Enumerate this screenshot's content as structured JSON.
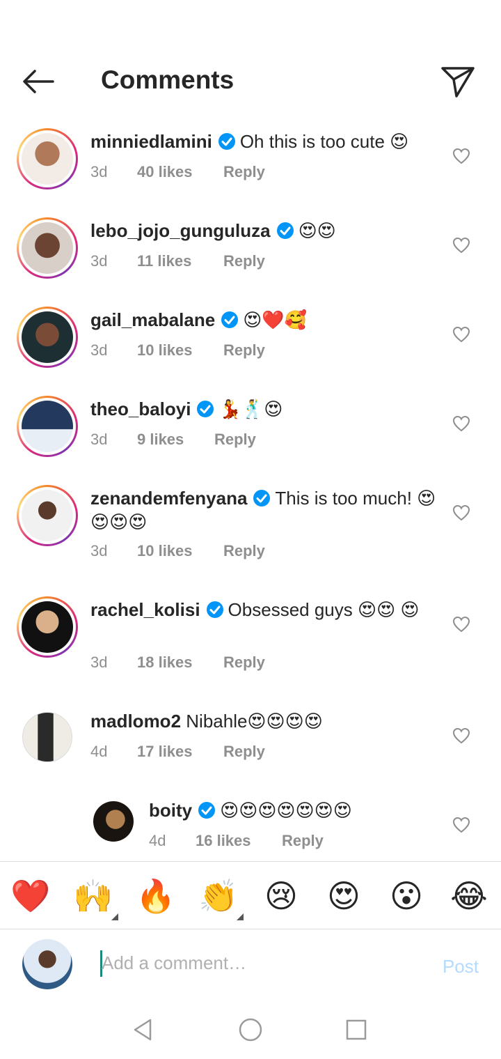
{
  "header": {
    "title": "Comments",
    "back_icon": "arrow-left-icon",
    "send_icon": "paper-plane-icon"
  },
  "comments": [
    {
      "username": "minniedlamini",
      "verified": true,
      "text": "Oh this is too cute 😍",
      "age": "3d",
      "likes": "40 likes",
      "reply": "Reply"
    },
    {
      "username": "lebo_jojo_gunguluza",
      "verified": true,
      "text": "😍😍",
      "age": "3d",
      "likes": "11 likes",
      "reply": "Reply"
    },
    {
      "username": "gail_mabalane",
      "verified": true,
      "text": "😍❤️🥰",
      "age": "3d",
      "likes": "10 likes",
      "reply": "Reply"
    },
    {
      "username": "theo_baloyi",
      "verified": true,
      "text": "💃🕺😍",
      "age": "3d",
      "likes": "9 likes",
      "reply": "Reply"
    },
    {
      "username": "zenandemfenyana",
      "verified": true,
      "text": "This is too much! 😍😍😍😍",
      "age": "3d",
      "likes": "10 likes",
      "reply": "Reply"
    },
    {
      "username": "rachel_kolisi",
      "verified": true,
      "text": "Obsessed guys 😍😍 😍",
      "age": "3d",
      "likes": "18 likes",
      "reply": "Reply"
    },
    {
      "username": "madlomo2",
      "verified": false,
      "text": "Nibahle😍😍😍😍",
      "age": "4d",
      "likes": "17 likes",
      "reply": "Reply"
    },
    {
      "username": "boity",
      "verified": true,
      "text": "😍😍😍😍😍😍😍",
      "age": "4d",
      "likes": "16 likes",
      "reply": "Reply"
    }
  ],
  "reactions": [
    "❤️",
    "🙌",
    "🔥",
    "👏",
    "😢",
    "😍",
    "😮",
    "😂"
  ],
  "compose": {
    "placeholder": "Add a comment…",
    "post_label": "Post"
  },
  "colors": {
    "accent": "#0095f6",
    "post_disabled": "#b3dbff",
    "meta_gray": "#8e8e8e"
  }
}
